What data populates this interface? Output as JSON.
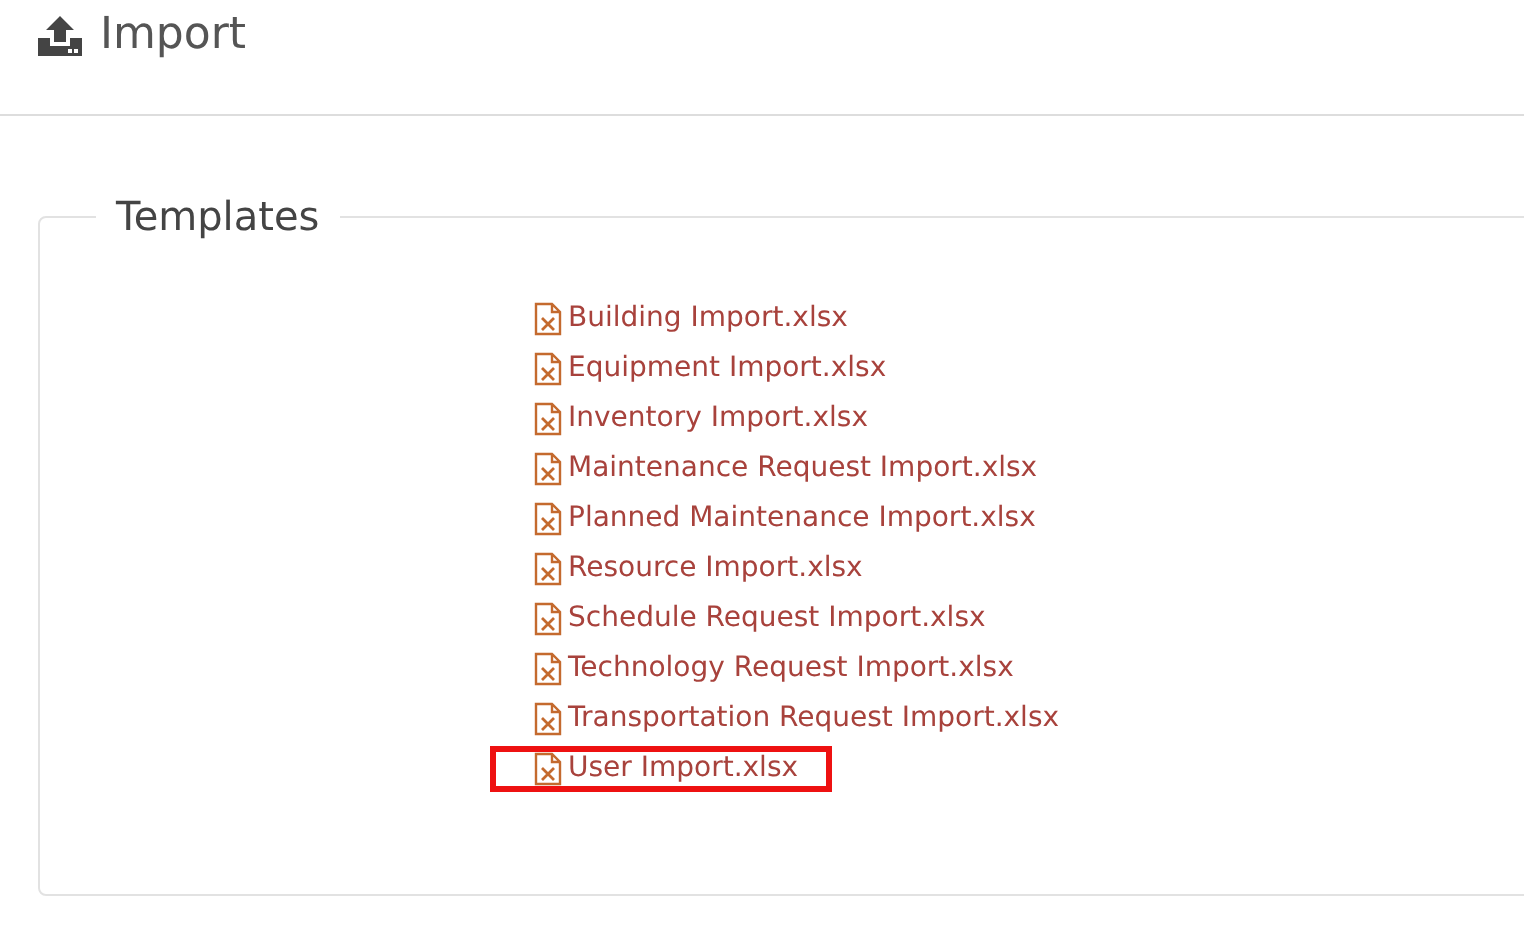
{
  "page": {
    "title": "Import"
  },
  "templates": {
    "legend": "Templates",
    "files": [
      {
        "name": "Building Import.xlsx",
        "highlighted": false
      },
      {
        "name": "Equipment Import.xlsx",
        "highlighted": false
      },
      {
        "name": "Inventory Import.xlsx",
        "highlighted": false
      },
      {
        "name": "Maintenance Request Import.xlsx",
        "highlighted": false
      },
      {
        "name": "Planned Maintenance Import.xlsx",
        "highlighted": false
      },
      {
        "name": "Resource Import.xlsx",
        "highlighted": false
      },
      {
        "name": "Schedule Request Import.xlsx",
        "highlighted": false
      },
      {
        "name": "Technology Request Import.xlsx",
        "highlighted": false
      },
      {
        "name": "Transportation Request Import.xlsx",
        "highlighted": false
      },
      {
        "name": "User Import.xlsx",
        "highlighted": true
      }
    ]
  }
}
